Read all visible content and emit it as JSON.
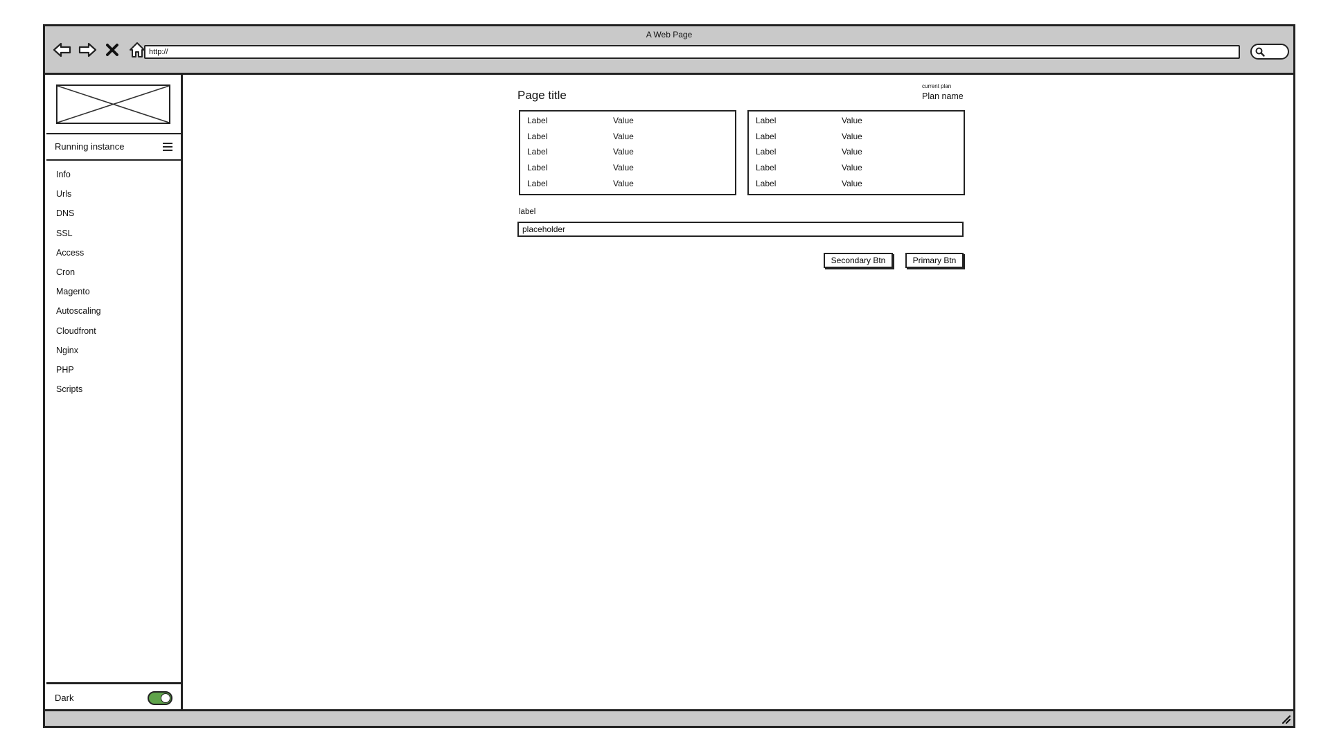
{
  "window": {
    "title": "A Web Page",
    "url": "http://"
  },
  "icons": {
    "back": "back-arrow-icon",
    "forward": "forward-arrow-icon",
    "stop": "close-x-icon",
    "home": "home-icon",
    "search": "search-icon",
    "menu": "hamburger-menu-icon",
    "logo": "image-placeholder-icon",
    "resize": "resize-grip-icon"
  },
  "sidebar": {
    "instance_label": "Running instance",
    "items": [
      {
        "label": "Info"
      },
      {
        "label": "Urls"
      },
      {
        "label": "DNS"
      },
      {
        "label": "SSL"
      },
      {
        "label": "Access"
      },
      {
        "label": "Cron"
      },
      {
        "label": "Magento"
      },
      {
        "label": "Autoscaling"
      },
      {
        "label": "Cloudfront"
      },
      {
        "label": "Nginx"
      },
      {
        "label": "PHP"
      },
      {
        "label": "Scripts"
      }
    ],
    "footer": {
      "dark_label": "Dark",
      "dark_toggle_on": true,
      "toggle_color": "#5fa34a"
    }
  },
  "main": {
    "page_title": "Page title",
    "current_plan_caption": "current plan",
    "plan_name": "Plan name",
    "cards": [
      {
        "rows": [
          {
            "label": "Label",
            "value": "Value"
          },
          {
            "label": "Label",
            "value": "Value"
          },
          {
            "label": "Label",
            "value": "Value"
          },
          {
            "label": "Label",
            "value": "Value"
          },
          {
            "label": "Label",
            "value": "Value"
          }
        ]
      },
      {
        "rows": [
          {
            "label": "Label",
            "value": "Value"
          },
          {
            "label": "Label",
            "value": "Value"
          },
          {
            "label": "Label",
            "value": "Value"
          },
          {
            "label": "Label",
            "value": "Value"
          },
          {
            "label": "Label",
            "value": "Value"
          }
        ]
      }
    ],
    "field": {
      "label": "label",
      "placeholder": "placeholder",
      "value": ""
    },
    "buttons": {
      "secondary": "Secondary Btn",
      "primary": "Primary Btn"
    }
  }
}
